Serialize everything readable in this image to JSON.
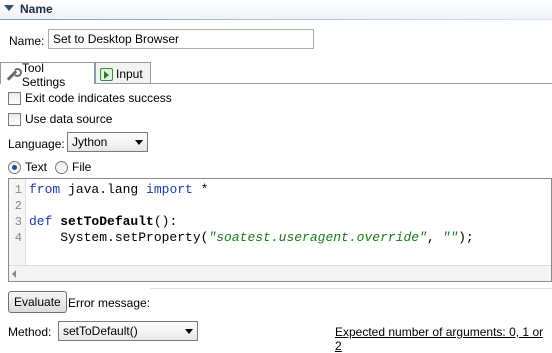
{
  "section": {
    "title": "Name"
  },
  "name_field": {
    "label": "Name:",
    "value": "Set to Desktop Browser"
  },
  "tabs": [
    {
      "label": "Tool Settings",
      "icon": "wrench-icon",
      "active": true
    },
    {
      "label": "Input",
      "icon": "input-icon",
      "active": false
    }
  ],
  "options": {
    "exit_code": {
      "label": "Exit code indicates success",
      "checked": false
    },
    "data_source": {
      "label": "Use data source",
      "checked": false
    }
  },
  "language": {
    "label": "Language:",
    "value": "Jython"
  },
  "source_mode": {
    "text": {
      "label": "Text",
      "checked": true
    },
    "file": {
      "label": "File",
      "checked": false
    }
  },
  "editor": {
    "line_numbers": [
      "1",
      "2",
      "3",
      "4"
    ],
    "lines": [
      {
        "kw1": "from",
        "t1": " java.lang ",
        "kw2": "import",
        "t2": " *"
      },
      {},
      {
        "kw": "def",
        "t1": " ",
        "fn": "setToDefault",
        "t2": "():"
      },
      {
        "t1": "    System.setProperty(",
        "s1": "\"soatest.useragent.override\"",
        "t2": ", ",
        "s2": "\"\"",
        "t3": ");"
      }
    ]
  },
  "evaluate_button": "Evaluate",
  "error_message_label": "Error message:",
  "method": {
    "label": "Method:",
    "value": "setToDefault()"
  },
  "expected_args": "Expected number of arguments: 0, 1 or 2"
}
